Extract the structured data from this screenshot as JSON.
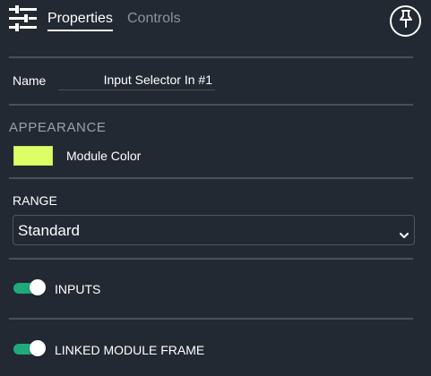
{
  "header": {
    "tabs": [
      {
        "label": "Properties",
        "active": true
      },
      {
        "label": "Controls",
        "active": false
      }
    ],
    "icons": {
      "menu": "sliders-icon",
      "pin": "pin-icon"
    }
  },
  "name_field": {
    "label": "Name",
    "value": "Input Selector In #1"
  },
  "appearance": {
    "title": "APPEARANCE",
    "module_color": {
      "label": "Module Color",
      "value": "#ddff66"
    }
  },
  "range": {
    "label": "RANGE",
    "selected": "Standard"
  },
  "toggles": [
    {
      "label": "INPUTS",
      "on": true
    },
    {
      "label": "LINKED MODULE FRAME",
      "on": true
    }
  ],
  "colors": {
    "background": "#232932",
    "toggle_on": "#1faa7c",
    "divider": "#4b5058",
    "muted_text": "#8b939c"
  }
}
